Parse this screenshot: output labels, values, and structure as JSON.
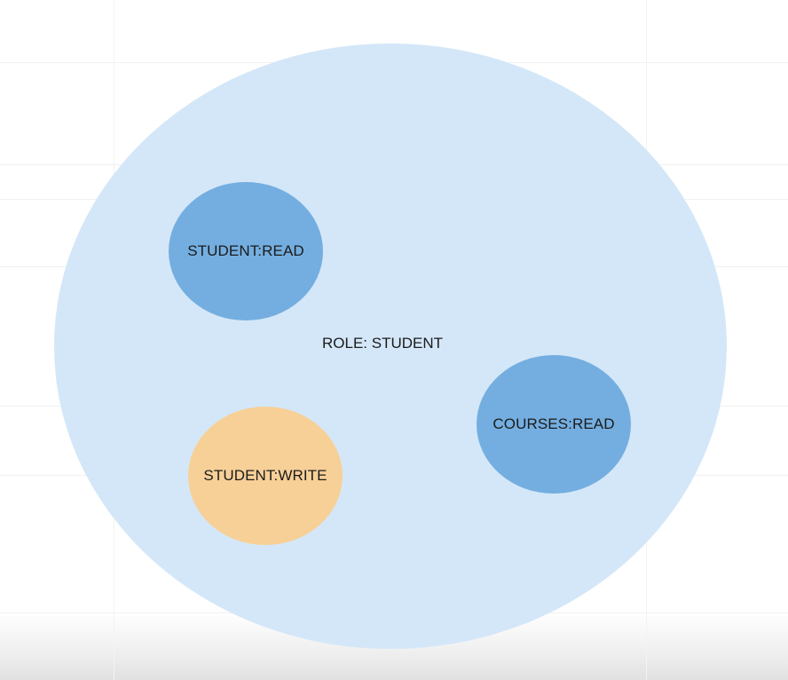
{
  "diagram": {
    "role": {
      "label": "ROLE: STUDENT",
      "color": "#d4e7f8"
    },
    "permissions": [
      {
        "label": "STUDENT:READ",
        "color": "#74aee0"
      },
      {
        "label": "COURSES:READ",
        "color": "#74aee0"
      },
      {
        "label": "STUDENT:WRITE",
        "color": "#f7d097"
      }
    ]
  }
}
